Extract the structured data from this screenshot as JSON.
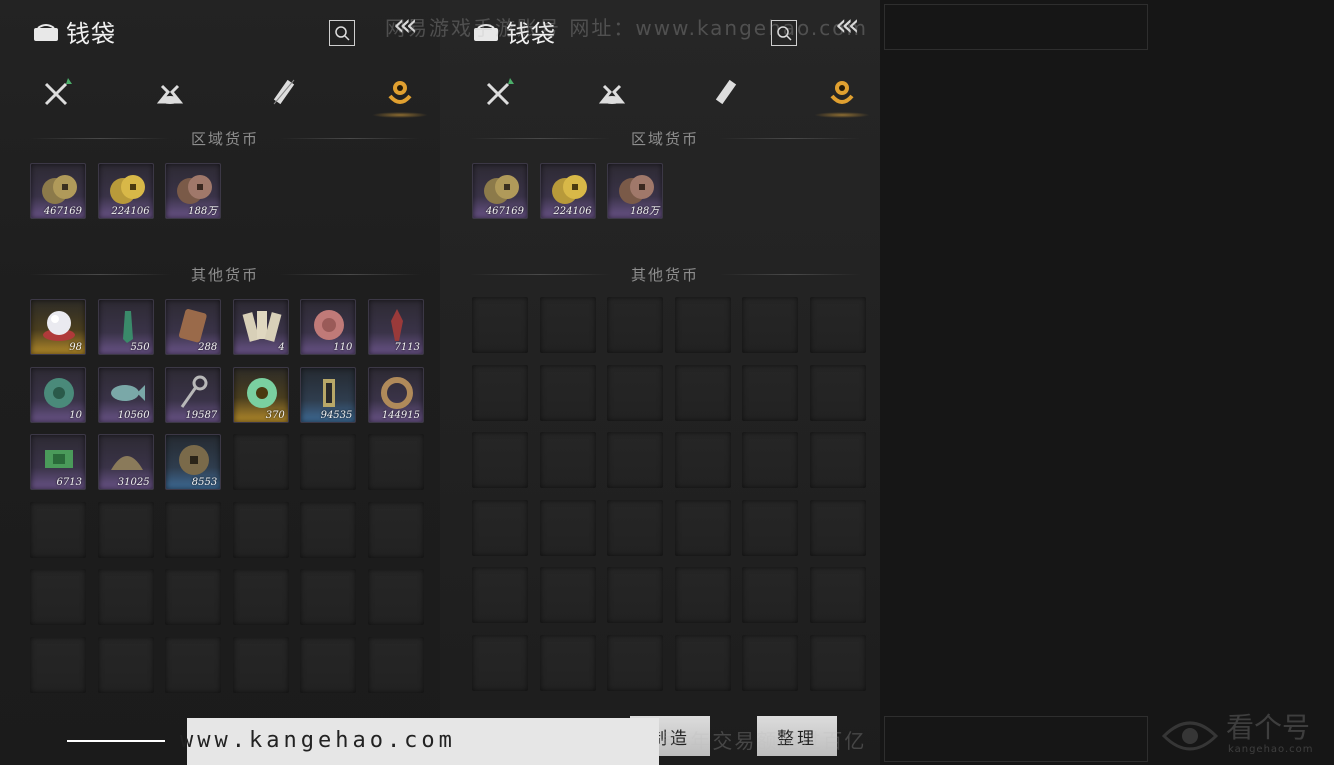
{
  "window": {
    "title": "钱袋"
  },
  "tabs": [
    {
      "icon": "swords-icon"
    },
    {
      "icon": "pouch-icon"
    },
    {
      "icon": "scroll-icon"
    },
    {
      "icon": "currency-icon",
      "active": true
    }
  ],
  "sections": {
    "regional": "区域货币",
    "other": "其他货币"
  },
  "regional_items_left": [
    {
      "icon": "copper-coins-icon",
      "qty": "467169"
    },
    {
      "icon": "gold-coins-icon",
      "qty": "224106"
    },
    {
      "icon": "bronze-coins-icon",
      "qty": "188万"
    }
  ],
  "regional_items_right": [
    {
      "icon": "copper-coins-icon",
      "qty": "467169"
    },
    {
      "icon": "gold-coins-icon",
      "qty": "224106"
    },
    {
      "icon": "bronze-coins-icon",
      "qty": "188万"
    }
  ],
  "other_items": [
    {
      "icon": "pearl-icon",
      "qty": "98",
      "rarity": "gold"
    },
    {
      "icon": "green-shard-icon",
      "qty": "550",
      "rarity": "purple"
    },
    {
      "icon": "copper-plate-icon",
      "qty": "288",
      "rarity": "purple"
    },
    {
      "icon": "paper-notes-icon",
      "qty": "4",
      "rarity": "purple"
    },
    {
      "icon": "pink-coin-icon",
      "qty": "110",
      "rarity": "purple"
    },
    {
      "icon": "red-shard-icon",
      "qty": "7113",
      "rarity": "purple"
    },
    {
      "icon": "jade-coin-icon",
      "qty": "10",
      "rarity": "purple"
    },
    {
      "icon": "fish-icon",
      "qty": "10560",
      "rarity": "purple"
    },
    {
      "icon": "key-icon",
      "qty": "19587",
      "rarity": "purple"
    },
    {
      "icon": "jade-ring-icon",
      "qty": "370",
      "rarity": "gold"
    },
    {
      "icon": "token-icon",
      "qty": "94535",
      "rarity": "blue"
    },
    {
      "icon": "bracelet-icon",
      "qty": "144915",
      "rarity": "purple"
    },
    {
      "icon": "green-note-icon",
      "qty": "6713",
      "rarity": "purple"
    },
    {
      "icon": "shell-icon",
      "qty": "31025",
      "rarity": "purple"
    },
    {
      "icon": "square-hole-coin-icon",
      "qty": "8553",
      "rarity": "blue"
    }
  ],
  "buttons": {
    "craft": "制造",
    "sort": "整理"
  },
  "watermark": {
    "top": "网易游戏手游账号   网址：www.kangehao.com",
    "bottom": "看个号专业网易游戏账号  年交易额超过百亿",
    "url": "www.kangehao.com",
    "logo_name": "看个号",
    "logo_sub": "kangehao.com"
  },
  "colors": {
    "gold": "#b38a2a",
    "purple": "#6a5488",
    "blue": "#3e6b96",
    "accent": "#e0a030"
  }
}
